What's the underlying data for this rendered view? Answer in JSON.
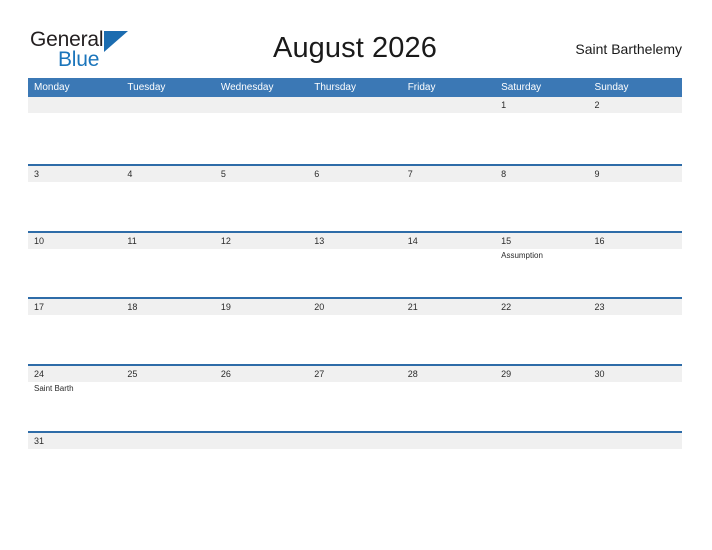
{
  "brand": {
    "name_part1": "General",
    "name_part2": "Blue",
    "flag_icon": "flag-triangle-icon",
    "color_dark": "#231f20",
    "color_blue": "#1b75bb"
  },
  "header": {
    "title": "August 2026",
    "region": "Saint Barthelemy"
  },
  "calendar": {
    "accent_color": "#3b78b5",
    "separator_color": "#2e6ca8",
    "date_band_color": "#f0f0f0",
    "weekdays": [
      "Monday",
      "Tuesday",
      "Wednesday",
      "Thursday",
      "Friday",
      "Saturday",
      "Sunday"
    ],
    "weeks": [
      [
        {
          "date": "",
          "events": []
        },
        {
          "date": "",
          "events": []
        },
        {
          "date": "",
          "events": []
        },
        {
          "date": "",
          "events": []
        },
        {
          "date": "",
          "events": []
        },
        {
          "date": "1",
          "events": []
        },
        {
          "date": "2",
          "events": []
        }
      ],
      [
        {
          "date": "3",
          "events": []
        },
        {
          "date": "4",
          "events": []
        },
        {
          "date": "5",
          "events": []
        },
        {
          "date": "6",
          "events": []
        },
        {
          "date": "7",
          "events": []
        },
        {
          "date": "8",
          "events": []
        },
        {
          "date": "9",
          "events": []
        }
      ],
      [
        {
          "date": "10",
          "events": []
        },
        {
          "date": "11",
          "events": []
        },
        {
          "date": "12",
          "events": []
        },
        {
          "date": "13",
          "events": []
        },
        {
          "date": "14",
          "events": []
        },
        {
          "date": "15",
          "events": [
            "Assumption"
          ]
        },
        {
          "date": "16",
          "events": []
        }
      ],
      [
        {
          "date": "17",
          "events": []
        },
        {
          "date": "18",
          "events": []
        },
        {
          "date": "19",
          "events": []
        },
        {
          "date": "20",
          "events": []
        },
        {
          "date": "21",
          "events": []
        },
        {
          "date": "22",
          "events": []
        },
        {
          "date": "23",
          "events": []
        }
      ],
      [
        {
          "date": "24",
          "events": [
            "Saint Barth"
          ]
        },
        {
          "date": "25",
          "events": []
        },
        {
          "date": "26",
          "events": []
        },
        {
          "date": "27",
          "events": []
        },
        {
          "date": "28",
          "events": []
        },
        {
          "date": "29",
          "events": []
        },
        {
          "date": "30",
          "events": []
        }
      ],
      [
        {
          "date": "31",
          "events": []
        },
        {
          "date": "",
          "events": []
        },
        {
          "date": "",
          "events": []
        },
        {
          "date": "",
          "events": []
        },
        {
          "date": "",
          "events": []
        },
        {
          "date": "",
          "events": []
        },
        {
          "date": "",
          "events": []
        }
      ]
    ]
  }
}
